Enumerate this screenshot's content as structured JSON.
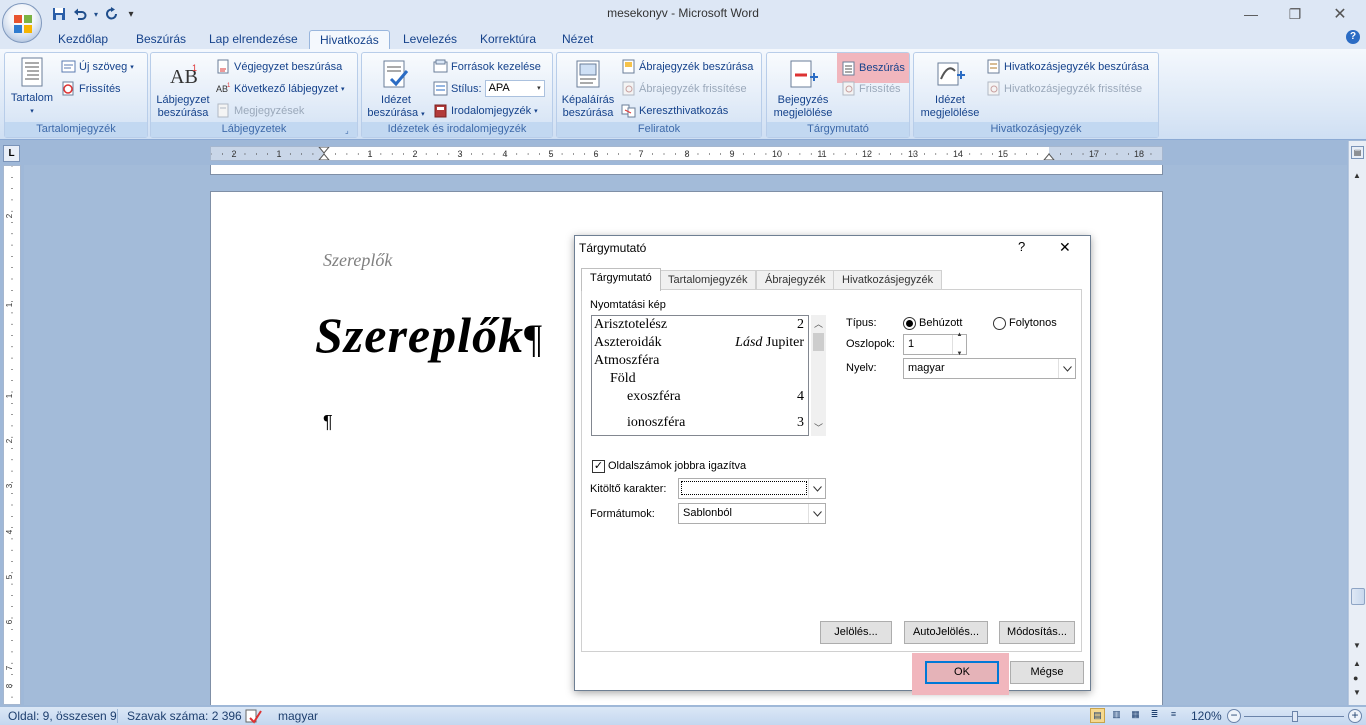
{
  "window": {
    "title": "mesekonyv - Microsoft Word",
    "controls": {
      "minimize": "—",
      "restore": "❐",
      "close": "✕"
    }
  },
  "quick_access": {
    "save": "💾",
    "undo": "↶",
    "redo": "↻",
    "more": "▾"
  },
  "tabs": [
    "Kezdőlap",
    "Beszúrás",
    "Lap elrendezése",
    "Hivatkozás",
    "Levelezés",
    "Korrektúra",
    "Nézet"
  ],
  "active_tab": "Hivatkozás",
  "ribbon": {
    "toc": {
      "label": "Tartalomjegyzék",
      "big": "Tartalom",
      "add_text": "Új szöveg",
      "update": "Frissítés"
    },
    "footnotes": {
      "label": "Lábjegyzetek",
      "big_line1": "Lábjegyzet",
      "big_line2": "beszúrása",
      "endnote": "Végjegyzet beszúrása",
      "next": "Következő lábjegyzet",
      "show": "Megjegyzések"
    },
    "citations": {
      "label": "Idézetek és irodalomjegyzék",
      "big_line1": "Idézet",
      "big_line2": "beszúrása",
      "manage": "Források kezelése",
      "style_label": "Stílus:",
      "style_value": "APA",
      "bibliography": "Irodalomjegyzék"
    },
    "captions": {
      "label": "Feliratok",
      "big_line1": "Képaláírás",
      "big_line2": "beszúrása",
      "insert_tof": "Ábrajegyzék beszúrása",
      "update_tof": "Ábrajegyzék frissítése",
      "cross_ref": "Kereszthivatkozás"
    },
    "index": {
      "label": "Tárgymutató",
      "big_line1": "Bejegyzés",
      "big_line2": "megjelölése",
      "insert": "Beszúrás",
      "update": "Frissítés"
    },
    "toa": {
      "label": "Hivatkozásjegyzék",
      "big_line1": "Idézet",
      "big_line2": "megjelölése",
      "insert": "Hivatkozásjegyzék beszúrása",
      "update": "Hivatkozásjegyzék frissítése"
    }
  },
  "ruler": {
    "h_labels": [
      "2",
      "1",
      "1",
      "2",
      "3",
      "4",
      "5",
      "6",
      "7",
      "8",
      "9",
      "10",
      "11",
      "12",
      "13",
      "14",
      "15",
      "17",
      "18"
    ],
    "v_labels": [
      "2",
      "1",
      "1",
      "2",
      "3",
      "4",
      "5",
      "6",
      "7",
      "8",
      "9"
    ]
  },
  "document": {
    "small_heading": "Szereplők",
    "big_heading": "Szereplők",
    "pilcrow": "¶",
    "cursor_mark": "¶"
  },
  "dialog": {
    "title": "Tárgymutató",
    "help": "?",
    "close": "✕",
    "tabs": [
      "Tárgymutató",
      "Tartalomjegyzék",
      "Ábrajegyzék",
      "Hivatkozásjegyzék"
    ],
    "preview_label": "Nyomtatási kép",
    "preview_rows": [
      {
        "text": "Arisztotelész",
        "num": "2",
        "indent": 0
      },
      {
        "text": "Aszteroidák",
        "see": "Lásd",
        "ref": "Jupiter",
        "indent": 0
      },
      {
        "text": "Atmoszféra",
        "num": "",
        "indent": 0
      },
      {
        "text": "Föld",
        "num": "",
        "indent": 1
      },
      {
        "text": "exoszféra",
        "num": "4",
        "indent": 2
      },
      {
        "text": "ionoszféra",
        "num": "3",
        "indent": 2
      }
    ],
    "type_label": "Típus:",
    "type_indented": "Behúzott",
    "type_runin": "Folytonos",
    "columns_label": "Oszlopok:",
    "columns_value": "1",
    "language_label": "Nyelv:",
    "language_value": "magyar",
    "right_align_label": "Oldalszámok jobbra igazítva",
    "right_align_checked": true,
    "leader_label": "Kitöltő karakter:",
    "leader_value": "",
    "formats_label": "Formátumok:",
    "formats_value": "Sablonból",
    "btn_mark": "Jelölés...",
    "btn_automark": "AutoJelölés...",
    "btn_modify": "Módosítás...",
    "btn_ok": "OK",
    "btn_cancel": "Mégse"
  },
  "status_bar": {
    "page": "Oldal: 9, összesen 9",
    "words": "Szavak száma: 2 396",
    "language": "magyar",
    "zoom": "120%"
  },
  "colors": {
    "accent": "#2b579a",
    "highlight": "#f1b6bd",
    "ribbon_text": "#15428b"
  }
}
